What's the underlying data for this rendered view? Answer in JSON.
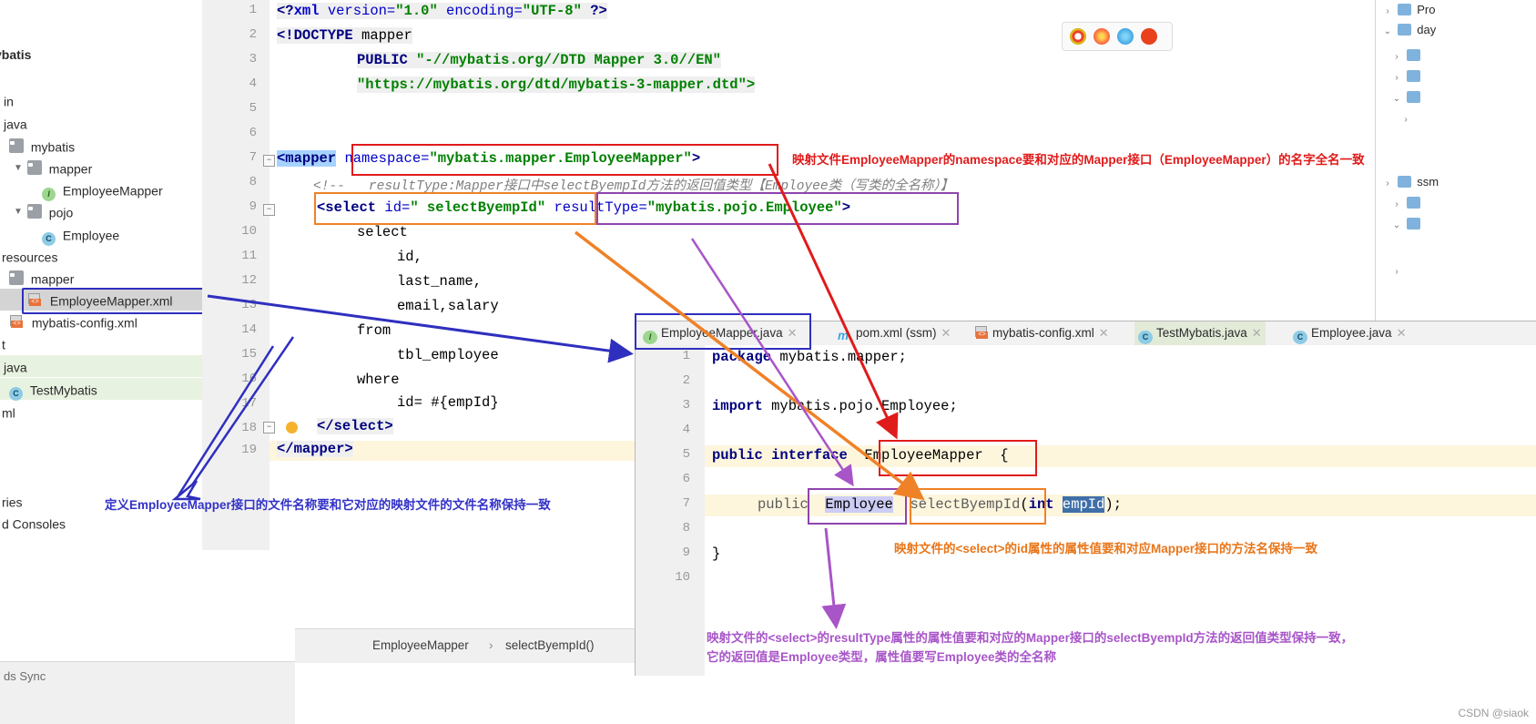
{
  "sidebar": {
    "title": "ybatis",
    "items": [
      {
        "label": "in",
        "indent": 0,
        "icon": "none",
        "chevron": ""
      },
      {
        "label": "java",
        "indent": 0,
        "icon": "none",
        "chevron": ""
      },
      {
        "label": "mybatis",
        "indent": 1,
        "icon": "folder-icon",
        "chevron": ""
      },
      {
        "label": "mapper",
        "indent": 2,
        "icon": "folder-icon",
        "chevron": "v"
      },
      {
        "label": "EmployeeMapper",
        "indent": 3,
        "icon": "interface-icon",
        "chevron": ""
      },
      {
        "label": "pojo",
        "indent": 2,
        "icon": "folder-icon",
        "chevron": "v"
      },
      {
        "label": "Employee",
        "indent": 3,
        "icon": "class-icon",
        "chevron": ""
      },
      {
        "label": "resources",
        "indent": 0,
        "icon": "none",
        "chevron": ""
      },
      {
        "label": "mapper",
        "indent": 1,
        "icon": "folder-icon",
        "chevron": ""
      },
      {
        "label": "EmployeeMapper.xml",
        "indent": 2,
        "icon": "xml-icon",
        "chevron": "",
        "selected": "grey"
      },
      {
        "label": "mybatis-config.xml",
        "indent": 1,
        "icon": "xml-icon",
        "chevron": ""
      },
      {
        "label": "t",
        "indent": 0,
        "icon": "none",
        "chevron": ""
      },
      {
        "label": "java",
        "indent": 0,
        "icon": "none",
        "chevron": "",
        "selected": "green"
      },
      {
        "label": "TestMybatis",
        "indent": 1,
        "icon": "class-icon",
        "chevron": "",
        "selected": "green"
      },
      {
        "label": "ml",
        "indent": 0,
        "icon": "none",
        "chevron": ""
      },
      {
        "label": "ries",
        "indent": 0,
        "icon": "none",
        "chevron": ""
      },
      {
        "label": "d Consoles",
        "indent": 0,
        "icon": "none",
        "chevron": ""
      }
    ]
  },
  "xml_editor": {
    "line_numbers": [
      "1",
      "2",
      "3",
      "4",
      "5",
      "6",
      "7",
      "8",
      "9",
      "10",
      "11",
      "12",
      "13",
      "14",
      "15",
      "16",
      "17",
      "18",
      "19"
    ],
    "lines": [
      "<?xml version=\"1.0\" encoding=\"UTF-8\" ?>",
      "<!DOCTYPE mapper",
      "        PUBLIC \"-//mybatis.org//DTD Mapper 3.0//EN\"",
      "        \"https://mybatis.org/dtd/mybatis-3-mapper.dtd\">",
      "",
      "",
      "<mapper namespace=\"mybatis.mapper.EmployeeMapper\">",
      "    <!--  resultType:Mapper接口中selectByempId方法的返回值类型【Employee类（写类的全名称）】",
      "    <select id=\" selectByempId\" resultType=\"mybatis.pojo.Employee\">",
      "        select",
      "            id,",
      "            last_name,",
      "            email,salary",
      "        from",
      "            tbl_employee",
      "        where",
      "            id= #{empId}",
      "    </select>",
      "</mapper>"
    ],
    "tokens": {
      "l1_a": "<?",
      "l1_b": "xml",
      "l1_c": " version=",
      "l1_d": "\"1.0\"",
      "l1_e": " encoding=",
      "l1_f": "\"UTF-8\"",
      "l1_g": " ?>",
      "l2_a": "<!DOCTYPE",
      "l2_b": " mapper",
      "l3_a": "PUBLIC",
      "l3_b": "\"-//mybatis.org//DTD Mapper 3.0//EN\"",
      "l4_a": "\"https://mybatis.org/dtd/mybatis-3-mapper.dtd\">",
      "l7_a": "<mapper",
      "l7_b": "namespace=",
      "l7_c": "\"mybatis.mapper.EmployeeMapper\"",
      "l7_d": ">",
      "l8_a": "<!--   resultType:Mapper接口中selectByempId方法的返回值类型【Employee类（写类的全名称）】",
      "l9_a": "<select ",
      "l9_b": "id=",
      "l9_c": "\" selectByempId\"",
      "l9_d": "resultType=",
      "l9_e": "\"mybatis.pojo.Employee\"",
      "l9_f": ">",
      "l10": "select",
      "l11": "id,",
      "l12": "last_name,",
      "l13": "email,salary",
      "l14": "from",
      "l15": "tbl_employee",
      "l16": "where",
      "l17": "id= #{empId}",
      "l18": "</select>",
      "l19": "</mapper>"
    }
  },
  "java_panel": {
    "tabs": [
      {
        "label": "EmployeeMapper.java",
        "icon": "interface-icon",
        "closable": true,
        "active": true
      },
      {
        "label": "pom.xml (ssm)",
        "icon": "maven-icon",
        "closable": true,
        "active": false
      },
      {
        "label": "mybatis-config.xml",
        "icon": "xml-icon",
        "closable": true,
        "active": false
      },
      {
        "label": "TestMybatis.java",
        "icon": "class-icon",
        "closable": true,
        "active": false,
        "highlight": true
      },
      {
        "label": "Employee.java",
        "icon": "class-icon",
        "closable": true,
        "active": false
      }
    ],
    "line_numbers": [
      "1",
      "2",
      "3",
      "4",
      "5",
      "6",
      "7",
      "8",
      "9",
      "10"
    ],
    "tokens": {
      "l1_kw": "package",
      "l1_rest": " mybatis.mapper;",
      "l3_kw": "import",
      "l3_rest": " mybatis.pojo.Employee;",
      "l5_kw1": "public",
      "l5_kw2": "interface",
      "l5_name": "EmployeeMapper",
      "l5_brace": "{",
      "l7_kw": "public",
      "l7_type": "Employee",
      "l7_method": "selectByempId",
      "l7_paren1": "(",
      "l7_int": "int",
      "l7_param": "empId",
      "l7_paren2": ");",
      "l9_brace": "}"
    }
  },
  "breadcrumb": {
    "item1": "EmployeeMapper",
    "separator": "›",
    "item2": "selectByempId()"
  },
  "annotations": [
    {
      "id": "namespace-note",
      "color": "#e01b1b",
      "text": "映射文件EmployeeMapper的namespace要和对应的Mapper接口（EmployeeMapper）的名字全名一致"
    },
    {
      "id": "file-name-note",
      "color": "#3232c8",
      "text": "定义EmployeeMapper接口的文件名称要和它对应的映射文件的文件名称保持一致"
    },
    {
      "id": "select-id-note",
      "color": "#e8761a",
      "text": "映射文件的<select>的id属性的属性值要和对应Mapper接口的方法名保持一致"
    },
    {
      "id": "result-type-note-line1",
      "color": "#a855c8",
      "text": "映射文件的<select>的resultType属性的属性值要和对应的Mapper接口的selectByempId方法的返回值类型保持一致，"
    },
    {
      "id": "result-type-note-line2",
      "color": "#a855c8",
      "text": "它的返回值是Employee类型，属性值要写Employee类的全名称"
    }
  ],
  "right_strip": {
    "rows": [
      {
        "label": "Pro",
        "chevron": ">"
      },
      {
        "label": "day",
        "chevron": "v"
      },
      {
        "label": "",
        "chevron": ">"
      },
      {
        "label": "",
        "chevron": ">"
      },
      {
        "label": "",
        "chevron": "v"
      },
      {
        "label": "",
        "chevron": ">"
      },
      {
        "label": "ssm",
        "chevron": ">"
      },
      {
        "label": "",
        "chevron": ">"
      },
      {
        "label": "",
        "chevron": "v"
      },
      {
        "label": "",
        "chevron": ">"
      }
    ]
  },
  "bottom_left": {
    "line1": "ds   Sync"
  },
  "watermark": "CSDN @siaok",
  "colors": {
    "red": "#e01b1b",
    "orange": "#ef8127",
    "purple": "#8e44ad",
    "blue": "#2f2fbf",
    "accent_tab": "#3f7fd6"
  }
}
